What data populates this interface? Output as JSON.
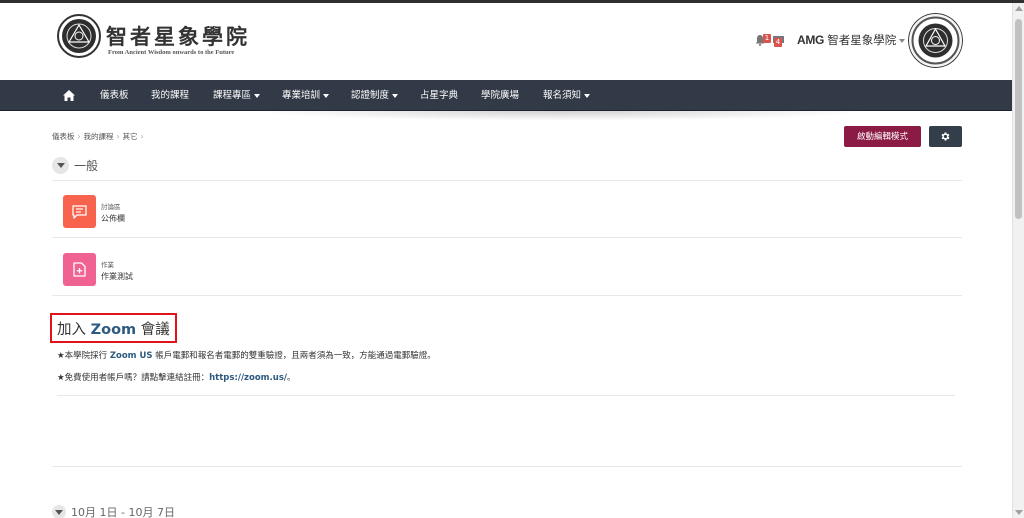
{
  "header": {
    "brand_title": "智者星象學院",
    "brand_subtitle": "From Ancient Wisdom onwards to the Future",
    "notification_count": "1",
    "message_count": "4",
    "user_prefix": "AMG",
    "user_name": " 智者星象學院"
  },
  "nav": {
    "items": [
      {
        "label": "儀表板",
        "has_menu": false
      },
      {
        "label": "我的課程",
        "has_menu": false
      },
      {
        "label": "課程專區",
        "has_menu": true
      },
      {
        "label": "專業培訓",
        "has_menu": true
      },
      {
        "label": "認證制度",
        "has_menu": true
      },
      {
        "label": "占星字典",
        "has_menu": false
      },
      {
        "label": "學院廣場",
        "has_menu": false
      },
      {
        "label": "報名須知",
        "has_menu": true
      }
    ]
  },
  "breadcrumb": [
    "儀表板",
    "我的課程",
    "其它"
  ],
  "buttons": {
    "edit_mode": "啟動編輯模式"
  },
  "section": {
    "title": "一般"
  },
  "activities": [
    {
      "type": "討論區",
      "name": "公佈欄",
      "color": "#f7634d"
    },
    {
      "type": "作業",
      "name": "作業測試",
      "color": "#f06292"
    }
  ],
  "zoom": {
    "title_prefix": "加入 ",
    "title_bold": "Zoom",
    "title_suffix": " 會議",
    "line1_prefix": "★本學院採行 ",
    "line1_bold": "Zoom US",
    "line1_suffix": " 帳戶電郵和報名者電郵的雙重驗證，且兩者須為一致，方能通過電郵驗證。",
    "line2_prefix": "★免費使用者帳戶嗎？請點擊連結註冊：",
    "line2_link": "https://zoom.us/",
    "line2_suffix": "。"
  },
  "next_section": {
    "title": "10月 1日 - 10月 7日"
  },
  "colors": {
    "navbar": "#313a46",
    "edit_button": "#8b1a44",
    "accent_blue": "#2d5a80",
    "highlight_box": "#e0131a"
  }
}
